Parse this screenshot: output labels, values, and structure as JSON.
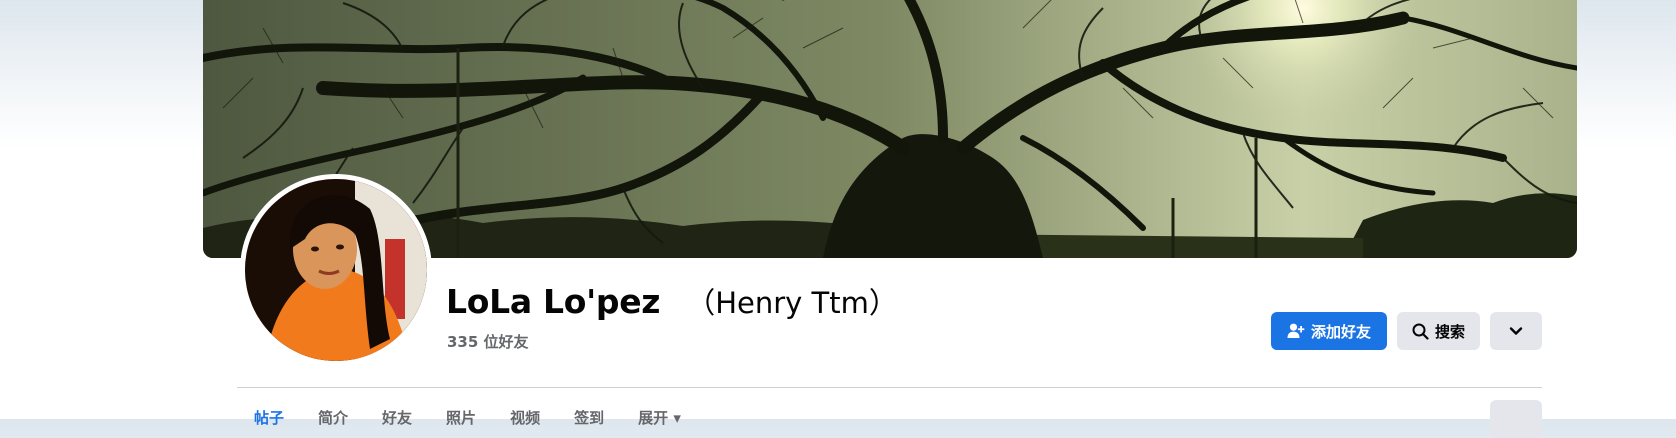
{
  "profile": {
    "name": "LoLa Lo'pez",
    "alternate_name": "（Henry Ttm）",
    "friend_count": "335 位好友"
  },
  "actions": {
    "add_friend_label": "添加好友",
    "search_label": "搜索"
  },
  "tabs": [
    {
      "label": "帖子",
      "active": true
    },
    {
      "label": "简介",
      "active": false
    },
    {
      "label": "好友",
      "active": false
    },
    {
      "label": "照片",
      "active": false
    },
    {
      "label": "视频",
      "active": false
    },
    {
      "label": "签到",
      "active": false
    },
    {
      "label": "展开 ▾",
      "active": false
    }
  ],
  "colors": {
    "accent": "#1b74e4",
    "secondary_button": "#e4e6eb",
    "text_primary": "#050505",
    "text_secondary": "#65676b"
  },
  "icons": {
    "add_friend": "person-plus-icon",
    "search": "search-icon",
    "more": "chevron-down-icon"
  }
}
